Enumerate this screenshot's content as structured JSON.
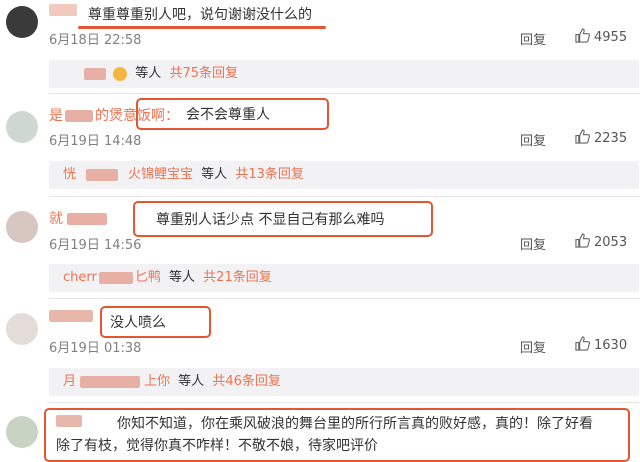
{
  "comments": [
    {
      "name_suffix": "",
      "text": "尊重尊重别人吧，说句谢谢没什么的",
      "time": "6月18日 22:58",
      "reply_label": "回复",
      "likes": "4955",
      "sub_replies": {
        "who": "",
        "mid": "等人",
        "total": "共75条回复"
      }
    },
    {
      "name_prefix": "是",
      "name_suffix": "的煲意饭啊：",
      "text": "会不会尊重人",
      "time": "6月19日 14:48",
      "reply_label": "回复",
      "likes": "2235",
      "sub_replies": {
        "who_prefix": "恍",
        "who": "火锦鲤宝宝",
        "mid": "等人",
        "total": "共13条回复"
      }
    },
    {
      "name_prefix": "就",
      "name_suffix": "",
      "text": "尊重别人话少点 不显自己有那么难吗",
      "time": "6月19日 14:56",
      "reply_label": "回复",
      "likes": "2053",
      "sub_replies": {
        "who_prefix": "cherr",
        "who": "匕鸭",
        "mid": "等人",
        "total": "共21条回复"
      }
    },
    {
      "name_suffix": "",
      "text": "没人喷么",
      "time": "6月19日 01:38",
      "reply_label": "回复",
      "likes": "1630",
      "sub_replies": {
        "who_prefix": "月",
        "who": "上你",
        "mid": "等人",
        "total": "共46条回复"
      }
    },
    {
      "text_line1": "你知不知道，你在乘风破浪的舞台里的所行所言真的败好感，真的！除了好看",
      "text_line2": "除了有枝，觉得你真不咋样！不敬不娘，待家吧评价"
    }
  ],
  "colors": {
    "highlight": "#e3562f",
    "name": "#eb7350",
    "reply_bg": "#f2f2f5"
  },
  "icons": {
    "like": "thumbs-up-icon"
  }
}
